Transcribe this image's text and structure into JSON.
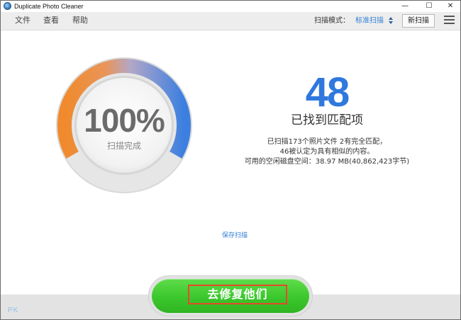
{
  "window": {
    "title": "Duplicate Photo Cleaner",
    "minimize_glyph": "—",
    "maximize_glyph": "☐",
    "close_glyph": "✕"
  },
  "menu": {
    "file": "文件",
    "view": "查看",
    "help": "帮助"
  },
  "toolbar": {
    "scan_mode_label": "扫描模式：",
    "scan_mode_value": "标准扫描",
    "new_scan_label": "新扫描"
  },
  "progress": {
    "percent_text": "100%",
    "percent_value": 100,
    "status": "扫描完成"
  },
  "results": {
    "match_count": "48",
    "found_label": "已找到匹配项",
    "summary_line1": "已扫描173个照片文件 2有完全匹配，",
    "summary_line2": "46被认定为具有相似的内容。",
    "summary_line3": "可用的空闲磁盘空间：38.97 MB(40,862,423字节)"
  },
  "actions": {
    "save_scan": "保存扫描",
    "fix_them": "去修复他们"
  },
  "footer": {
    "logo_text": "PK"
  },
  "colors": {
    "accent_blue": "#2f78dd",
    "ring_orange": "#f08a2c",
    "ring_blue": "#3c7fe0",
    "button_green": "#3cc72d",
    "highlight_red": "#e54b2a"
  }
}
